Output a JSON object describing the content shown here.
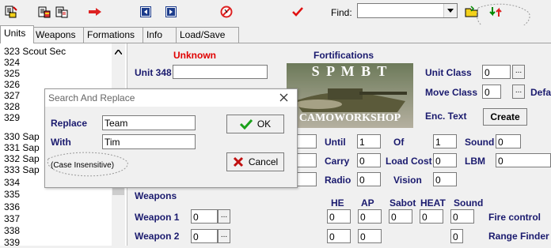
{
  "toolbar": {
    "find_label": "Find:",
    "find_value": "",
    "icons": [
      "copy-icon",
      "paste-icon",
      "arrow-right-icon",
      "nav-prev-icon",
      "nav-next-icon",
      "no-entry-icon",
      "checkmark-icon",
      "find-icon",
      "swap-icon"
    ]
  },
  "tabs": [
    "Units",
    "Weapons",
    "Formations",
    "Info",
    "Load/Save"
  ],
  "unit_list": [
    {
      "num": "323",
      "name": "Scout Sec"
    },
    {
      "num": "324",
      "name": ""
    },
    {
      "num": "325",
      "name": ""
    },
    {
      "num": "326",
      "name": ""
    },
    {
      "num": "327",
      "name": ""
    },
    {
      "num": "328",
      "name": ""
    },
    {
      "num": "329",
      "name": ""
    },
    {
      "num": "330",
      "name": "Sap"
    },
    {
      "num": "331",
      "name": "Sap"
    },
    {
      "num": "332",
      "name": "Sap"
    },
    {
      "num": "333",
      "name": "Sap"
    },
    {
      "num": "334",
      "name": ""
    },
    {
      "num": "335",
      "name": ""
    },
    {
      "num": "336",
      "name": ""
    },
    {
      "num": "337",
      "name": ""
    },
    {
      "num": "338",
      "name": ""
    },
    {
      "num": "339",
      "name": ""
    }
  ],
  "editor": {
    "unknown_label": "Unknown",
    "fortifications_label": "Fortifications",
    "unit_label": "Unit 348",
    "unit_value": "",
    "logo_top": "S P M B T",
    "logo_bottom": "CAMOWORKSHOP",
    "unit_class_label": "Unit Class",
    "unit_class_value": "0",
    "move_class_label": "Move Class",
    "move_class_value": "0",
    "defa_label": "Defa",
    "enc_text_label": "Enc. Text",
    "create_label": "Create",
    "until_label": "Until",
    "until_value": "1",
    "of_label": "Of",
    "of_value": "1",
    "sound_label": "Sound",
    "sound_value": "0",
    "carry_label": "Carry",
    "carry_value": "0",
    "load_cost_label": "Load Cost",
    "load_cost_value": "0",
    "lbm_label": "LBM",
    "lbm_value": "0",
    "radio_label": "Radio",
    "radio_value": "0",
    "vision_label": "Vision",
    "vision_value": "0",
    "weapons_label": "Weapons",
    "col_he": "HE",
    "col_ap": "AP",
    "col_sabot": "Sabot",
    "col_heat": "HEAT",
    "col_sound": "Sound",
    "weapon1_label": "Weapon 1",
    "weapon1_value": "0",
    "weapon1_he": "0",
    "weapon1_ap": "0",
    "weapon1_sabot": "0",
    "weapon1_heat": "0",
    "weapon1_sound": "0",
    "fire_control_label": "Fire control",
    "weapon2_label": "Weapon 2",
    "weapon2_value": "0",
    "weapon2_he": "0",
    "weapon2_ap": "0",
    "weapon2_sound": "0",
    "range_finder_label": "Range Finder"
  },
  "dialog": {
    "title": "Search And Replace",
    "replace_label": "Replace",
    "replace_value": "Team",
    "with_label": "With",
    "with_value": "Tim",
    "case_note": "(Case Insensitive)",
    "ok_label": "OK",
    "cancel_label": "Cancel"
  }
}
